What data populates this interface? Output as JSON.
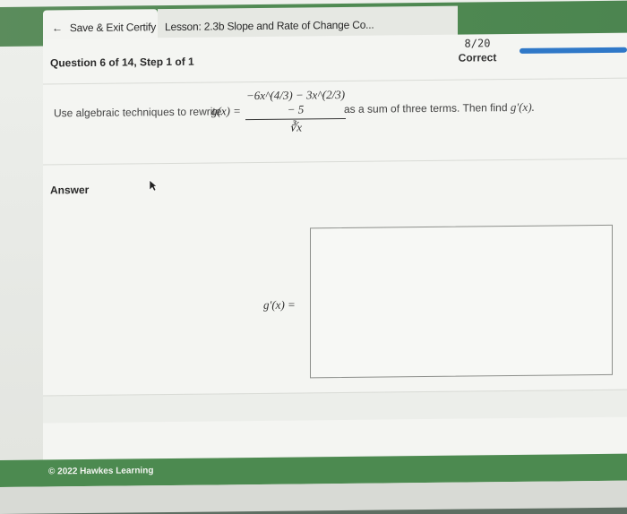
{
  "header": {
    "exit_label": "Save & Exit Certify",
    "lesson_label": "Lesson: 2.3b Slope and Rate of Change Co..."
  },
  "question": {
    "title": "Question 6 of 14, Step 1 of 1",
    "score": "8/20",
    "status": "Correct",
    "progress": 0.4
  },
  "problem": {
    "prompt_before": "Use algebraic techniques to rewrite",
    "function_expr": "g(x) =",
    "numerator": "−6x^(4/3) − 3x^(2/3) − 5",
    "denominator": "∛x",
    "prompt_after": "as a sum of three terms. Then find",
    "derivative_expr": "g′(x)."
  },
  "answer": {
    "label": "Answer",
    "input_label": "g′(x) =",
    "value": ""
  },
  "footer": {
    "copyright": "© 2022 Hawkes Learning"
  },
  "colors": {
    "brand_green": "#4c8a50",
    "progress_blue": "#2f78c8"
  }
}
